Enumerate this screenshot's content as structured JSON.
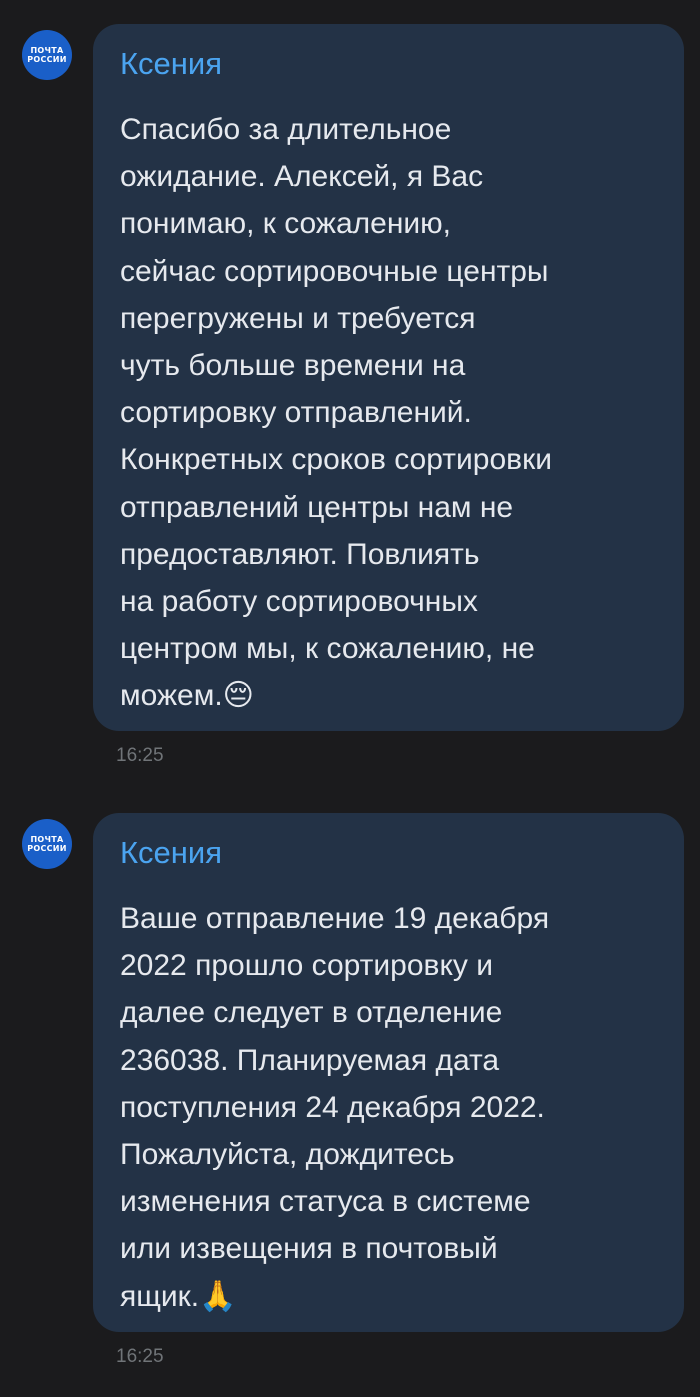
{
  "messages": [
    {
      "avatar_lines": [
        "ПОЧТА",
        "РОССИИ"
      ],
      "sender": "Ксения",
      "text": "Спасибо за длительное\nожидание. Алексей, я Вас\nпонимаю, к сожалению,\nсейчас сортировочные центры\nперегружены и требуется\nчуть больше времени на\nсортировку отправлений.\nКонкретных сроков сортировки\nотправлений центры нам не\nпредоставляют. Повлиять\nна работу сортировочных\nцентром мы, к сожалению, не\nможем.😔",
      "time": "16:25"
    },
    {
      "avatar_lines": [
        "ПОЧТА",
        "РОССИИ"
      ],
      "sender": "Ксения",
      "text": "Ваше отправление 19 декабря\n2022 прошло сортировку и\nдалее следует в отделение\n236038. Планируемая дата\nпоступления 24 декабря 2022.\nПожалуйста, дождитесь\nизменения статуса в системе\nили извещения в почтовый\nящик.🙏",
      "time": "16:25"
    }
  ],
  "colors": {
    "background": "#1b1b1d",
    "bubble": "#233246",
    "sender": "#4ba4f0",
    "text": "#e6e9ee",
    "time": "#707478",
    "avatar": "#1a5fc8"
  },
  "icons": {
    "avatar": "pochta-rossii-logo"
  }
}
